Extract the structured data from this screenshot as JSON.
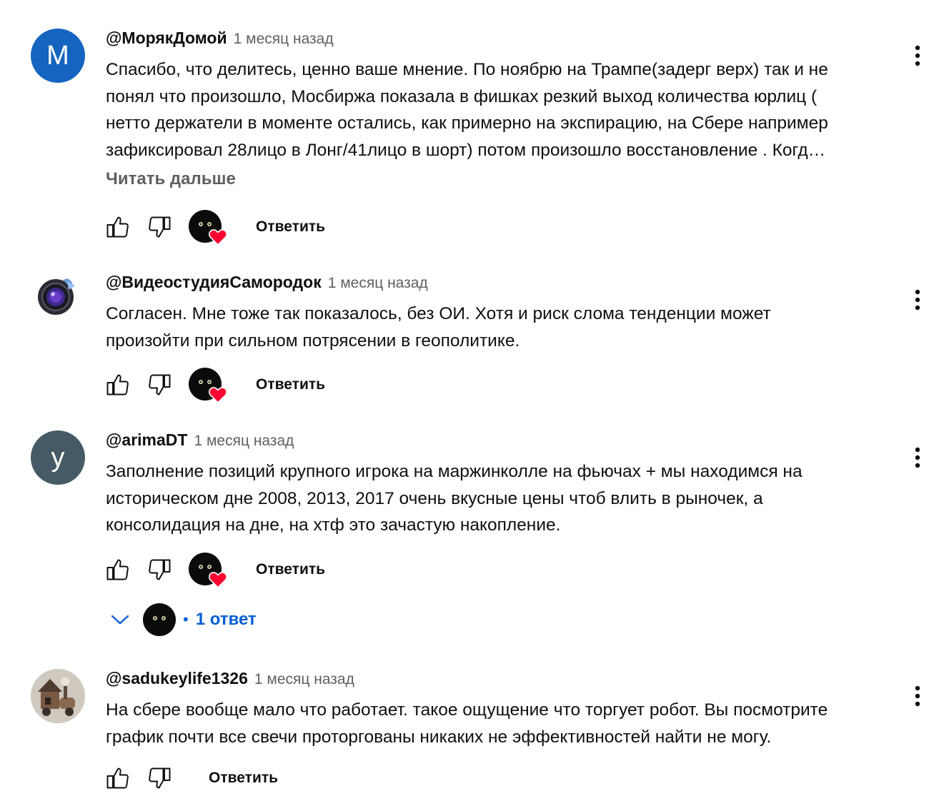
{
  "comments": [
    {
      "author": "@МорякДомой",
      "time": "1 месяц назад",
      "avatar_letter": "M",
      "avatar_color": "#1565c0",
      "lines": [
        "Спасибо, что делитесь, ценно ваше мнение. По ноябрю на Трампе(задерг верх) так и не",
        "понял что произошло, Мосбиржа показала в фишках резкий выход количества юрлиц (",
        "нетто держатели в моменте остались, как примерно на экспирацию, на Сбере например",
        "зафиксировал 28лицо в Лонг/41лицо в шорт) потом произошло восстановление . Когд…"
      ],
      "read_more": "Читать дальше",
      "reply_label": "Ответить"
    },
    {
      "author": "@ВидеостудияСамородок",
      "time": "1 месяц назад",
      "avatar_icon": "camera-lens-logo",
      "lines": [
        "Согласен. Мне тоже так показалось, без ОИ. Хотя и риск слома тенденции может",
        "произойти при сильном потрясении в геополитике."
      ],
      "reply_label": "Ответить"
    },
    {
      "author": "@arimaDT",
      "time": "1 месяц назад",
      "avatar_letter": "у",
      "avatar_color": "#455a64",
      "lines": [
        "Заполнение позиций крупного игрока на маржинколле на фьючах + мы находимся на",
        "историческом дне 2008, 2013, 2017 очень вкусные цены чтоб влить в рыночек, а",
        "консолидация на дне, на хтф это зачастую накопление."
      ],
      "reply_label": "Ответить",
      "replies_toggle": {
        "separator": "•",
        "label": "1 ответ"
      }
    },
    {
      "author": "@sadukeylife1326",
      "time": "1 месяц назад",
      "avatar_icon": "steampunk-house-photo",
      "lines": [
        "На сбере вообще мало что работает. такое ощущение что торгует робот. Вы посмотрите",
        "график почти все свечи проторгованы никаких не эффективностей найти не могу."
      ],
      "reply_label": "Ответить"
    }
  ],
  "colors": {
    "text": "#0f0f0f",
    "secondary": "#606060",
    "link_blue": "#065fd4",
    "heart_red": "#ff0033"
  }
}
